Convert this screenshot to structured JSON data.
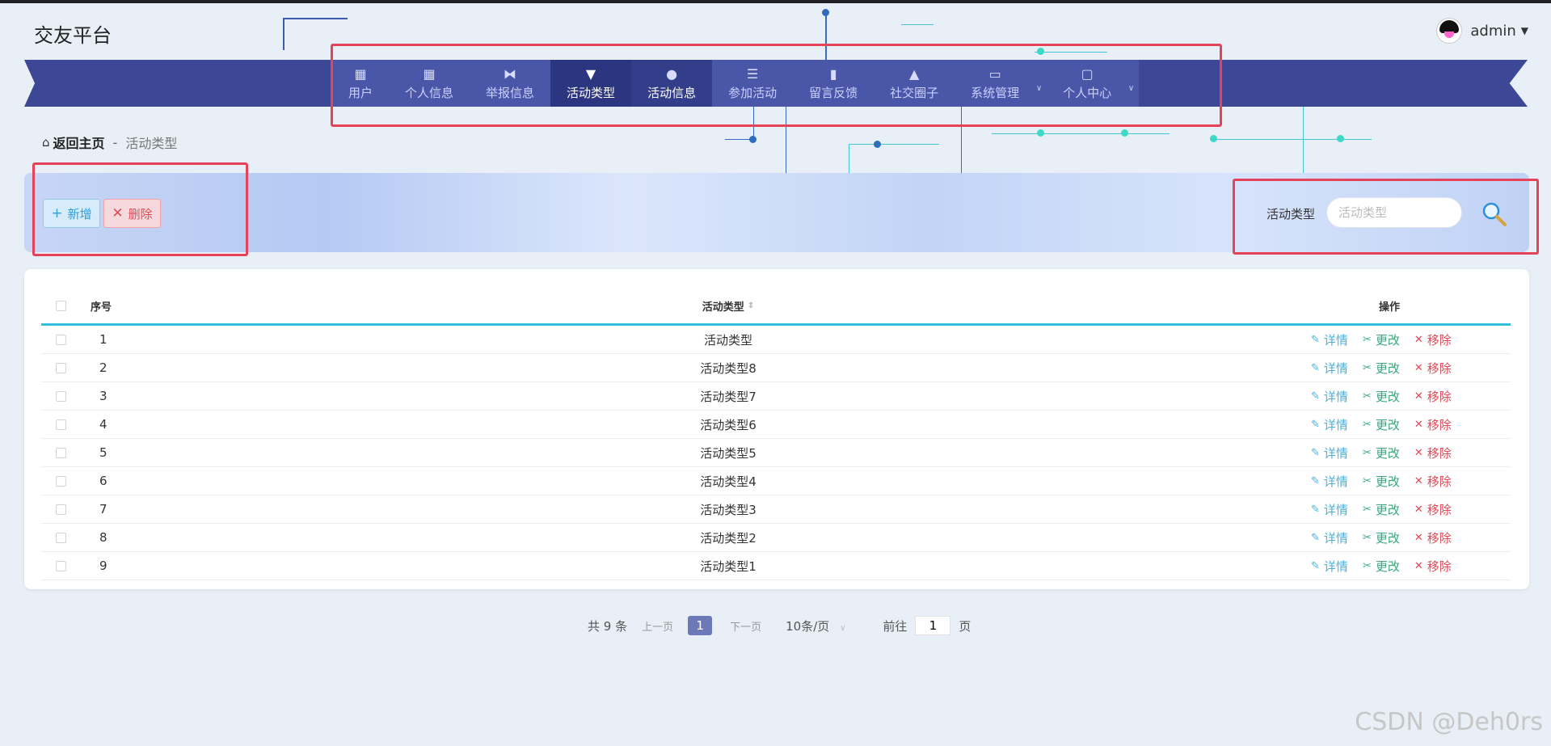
{
  "app": {
    "title": "交友平台"
  },
  "user": {
    "name": "admin"
  },
  "nav": [
    {
      "label": "用户",
      "icon": "grid-icon"
    },
    {
      "label": "个人信息",
      "icon": "grid-icon"
    },
    {
      "label": "举报信息",
      "icon": "ticket-icon"
    },
    {
      "label": "活动类型",
      "icon": "brush-icon",
      "active": true
    },
    {
      "label": "活动信息",
      "icon": "lightbulb-icon"
    },
    {
      "label": "参加活动",
      "icon": "list-icon"
    },
    {
      "label": "留言反馈",
      "icon": "bar-chart-icon"
    },
    {
      "label": "社交圈子",
      "icon": "person-icon"
    },
    {
      "label": "系统管理",
      "icon": "monitor-icon",
      "dropdown": true
    },
    {
      "label": "个人中心",
      "icon": "wallet-icon",
      "dropdown": true
    }
  ],
  "breadcrumb": {
    "home": "返回主页",
    "separator": "-",
    "current": "活动类型"
  },
  "toolbar": {
    "add_label": "新增",
    "delete_label": "删除"
  },
  "search": {
    "label": "活动类型",
    "placeholder": "活动类型"
  },
  "table": {
    "headers": {
      "index": "序号",
      "type": "活动类型",
      "ops": "操作"
    },
    "rows": [
      {
        "index": "1",
        "type": "活动类型"
      },
      {
        "index": "2",
        "type": "活动类型8"
      },
      {
        "index": "3",
        "type": "活动类型7"
      },
      {
        "index": "4",
        "type": "活动类型6"
      },
      {
        "index": "5",
        "type": "活动类型5"
      },
      {
        "index": "6",
        "type": "活动类型4"
      },
      {
        "index": "7",
        "type": "活动类型3"
      },
      {
        "index": "8",
        "type": "活动类型2"
      },
      {
        "index": "9",
        "type": "活动类型1"
      }
    ],
    "actions": {
      "detail": "详情",
      "edit": "更改",
      "remove": "移除"
    }
  },
  "pagination": {
    "total": "共 9 条",
    "prev": "上一页",
    "current": "1",
    "next": "下一页",
    "page_size": "10条/页",
    "goto_prefix": "前往",
    "goto_value": "1",
    "goto_suffix": "页"
  },
  "watermark": "CSDN @Deh0rs",
  "colors": {
    "nav_bg": "#4a56a8",
    "nav_active": "#2c3580",
    "accent": "#34bfdc",
    "highlight_box": "#e4435a"
  }
}
